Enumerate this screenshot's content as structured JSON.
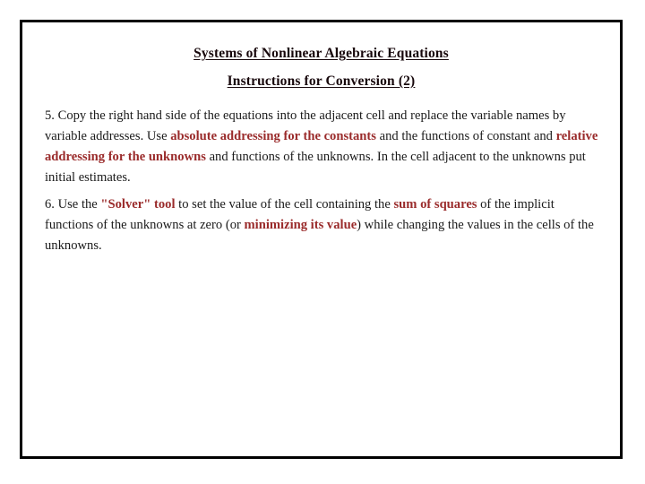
{
  "slide": {
    "title_line_1": "Systems of Nonlinear Algebraic Equations",
    "title_line_2": "Instructions for Conversion (2)",
    "title_color": "#17070b",
    "highlight_color": "#9a2b2b",
    "body_color": "#1a1a1a",
    "frame_color": "#000000",
    "background_color": "#ffffff"
  },
  "paragraphs": {
    "item_5": {
      "seg_1": "5. Copy the right hand side of the equations into the adjacent cell and replace the variable names by variable addresses. Use ",
      "seg_2_highlight": "absolute addressing for the constants",
      "seg_3": " and the functions of constant and ",
      "seg_4_highlight": "relative addressing for the unknowns",
      "seg_5": " and functions of the unknowns. In the cell adjacent to the unknowns put initial estimates."
    },
    "item_6": {
      "seg_1": "6. Use the ",
      "seg_2_highlight": "\"Solver\" tool",
      "seg_3": " to set the value of the cell containing the ",
      "seg_4_highlight": "sum of squares",
      "seg_5": " of the implicit functions of the unknowns at zero (or ",
      "seg_6_highlight": "minimizing its value",
      "seg_7": ") while changing the values in the cells of the unknowns."
    }
  }
}
